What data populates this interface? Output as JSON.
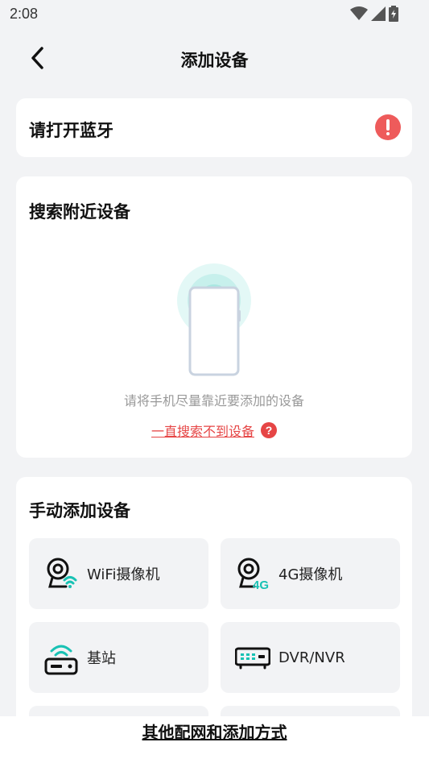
{
  "status_bar": {
    "time": "2:08"
  },
  "header": {
    "title": "添加设备"
  },
  "bluetooth": {
    "label": "请打开蓝牙"
  },
  "search": {
    "title": "搜索附近设备",
    "hint": "请将手机尽量靠近要添加的设备",
    "not_found_link": "一直搜索不到设备",
    "help_glyph": "?"
  },
  "manual": {
    "title": "手动添加设备",
    "devices": [
      {
        "label": "WiFi摄像机",
        "icon": "wifi-camera-icon"
      },
      {
        "label": "4G摄像机",
        "icon": "4g-camera-icon"
      },
      {
        "label": "基站",
        "icon": "base-station-icon"
      },
      {
        "label": "DVR/NVR",
        "icon": "dvr-nvr-icon"
      }
    ]
  },
  "footer": {
    "other_methods": "其他配网和添加方式"
  },
  "colors": {
    "accent": "#19c2b4",
    "alert": "#ee5b5b",
    "link": "#e64545",
    "background": "#f2f3f5"
  }
}
